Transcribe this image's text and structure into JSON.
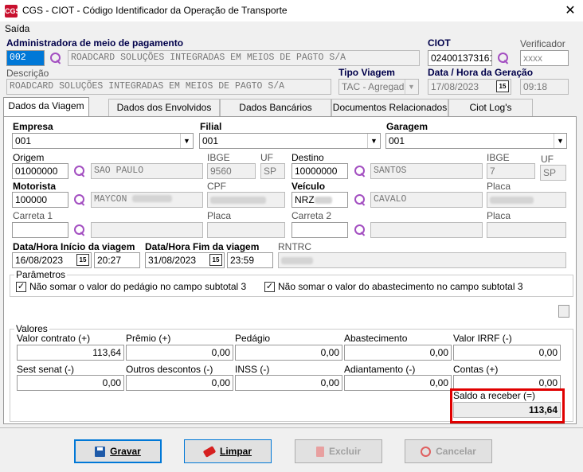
{
  "window": {
    "title": "CGS - CIOT - Código Identificador da Operação de Transporte",
    "menu": "Saída",
    "logo": "CGS"
  },
  "admin": {
    "label": "Administradora de meio de pagamento",
    "code": "002",
    "name": "ROADCARD SOLUÇÕES INTEGRADAS EM MEIOS DE PAGTO S/A"
  },
  "ciot": {
    "label": "CIOT",
    "value": "024001373161",
    "verif_label": "Verificador",
    "verif_value": "xxxx"
  },
  "descricao": {
    "label": "Descrição",
    "value": "ROADCARD SOLUÇÕES INTEGRADAS EM MEIOS DE PAGTO S/A"
  },
  "tipo_viagem": {
    "label": "Tipo Viagem",
    "value": "TAC - Agregado"
  },
  "data_geracao": {
    "label": "Data / Hora da Geração",
    "date": "17/08/2023",
    "time": "09:18"
  },
  "tabs": [
    "Dados da Viagem",
    "Dados dos Envolvidos",
    "Dados Bancários",
    "Documentos Relacionados",
    "Ciot Log's"
  ],
  "empresa": {
    "label": "Empresa",
    "value": "001"
  },
  "filial": {
    "label": "Filial",
    "value": "001"
  },
  "garagem": {
    "label": "Garagem",
    "value": "001"
  },
  "origem": {
    "label": "Origem",
    "value": "01000000",
    "city": "SAO PAULO",
    "ibge_label": "IBGE",
    "ibge": "9560",
    "uf_label": "UF",
    "uf": "SP"
  },
  "destino": {
    "label": "Destino",
    "value": "10000000",
    "city": "SANTOS",
    "ibge_label": "IBGE",
    "ibge": "7",
    "uf_label": "UF",
    "uf": "SP"
  },
  "motorista": {
    "label": "Motorista",
    "value": "100000",
    "name": "MAYCON",
    "cpf_label": "CPF"
  },
  "veiculo": {
    "label": "Veículo",
    "value": "NRZ",
    "name": "CAVALO",
    "placa_label": "Placa"
  },
  "carreta1": {
    "label": "Carreta 1",
    "placa_label": "Placa"
  },
  "carreta2": {
    "label": "Carreta 2",
    "placa_label": "Placa"
  },
  "inicio": {
    "label": "Data/Hora Início da viagem",
    "date": "16/08/2023",
    "time": "20:27"
  },
  "fim": {
    "label": "Data/Hora Fim da viagem",
    "date": "31/08/2023",
    "time": "23:59"
  },
  "rntrc": {
    "label": "RNTRC"
  },
  "parametros": {
    "label": "Parâmetros",
    "opt1": "Não somar o valor do pedágio no campo subtotal 3",
    "opt2": "Não somar o valor do abastecimento no campo subtotal 3"
  },
  "valores": {
    "label": "Valores",
    "valor_contrato": {
      "label": "Valor contrato (+)",
      "value": "113,64"
    },
    "premio": {
      "label": "Prêmio (+)",
      "value": "0,00"
    },
    "pedagio": {
      "label": "Pedágio",
      "value": "0,00"
    },
    "abastecimento": {
      "label": "Abastecimento",
      "value": "0,00"
    },
    "irrf": {
      "label": "Valor IRRF (-)",
      "value": "0,00"
    },
    "sest": {
      "label": "Sest senat (-)",
      "value": "0,00"
    },
    "outros": {
      "label": "Outros descontos (-)",
      "value": "0,00"
    },
    "inss": {
      "label": "INSS (-)",
      "value": "0,00"
    },
    "adiantamento": {
      "label": "Adiantamento (-)",
      "value": "0,00"
    },
    "contas": {
      "label": "Contas (+)",
      "value": "0,00"
    },
    "saldo": {
      "label": "Saldo a receber (=)",
      "value": "113,64"
    }
  },
  "buttons": {
    "gravar": "Gravar",
    "limpar": "Limpar",
    "excluir": "Excluir",
    "cancelar": "Cancelar"
  },
  "calendar_glyph": "15"
}
